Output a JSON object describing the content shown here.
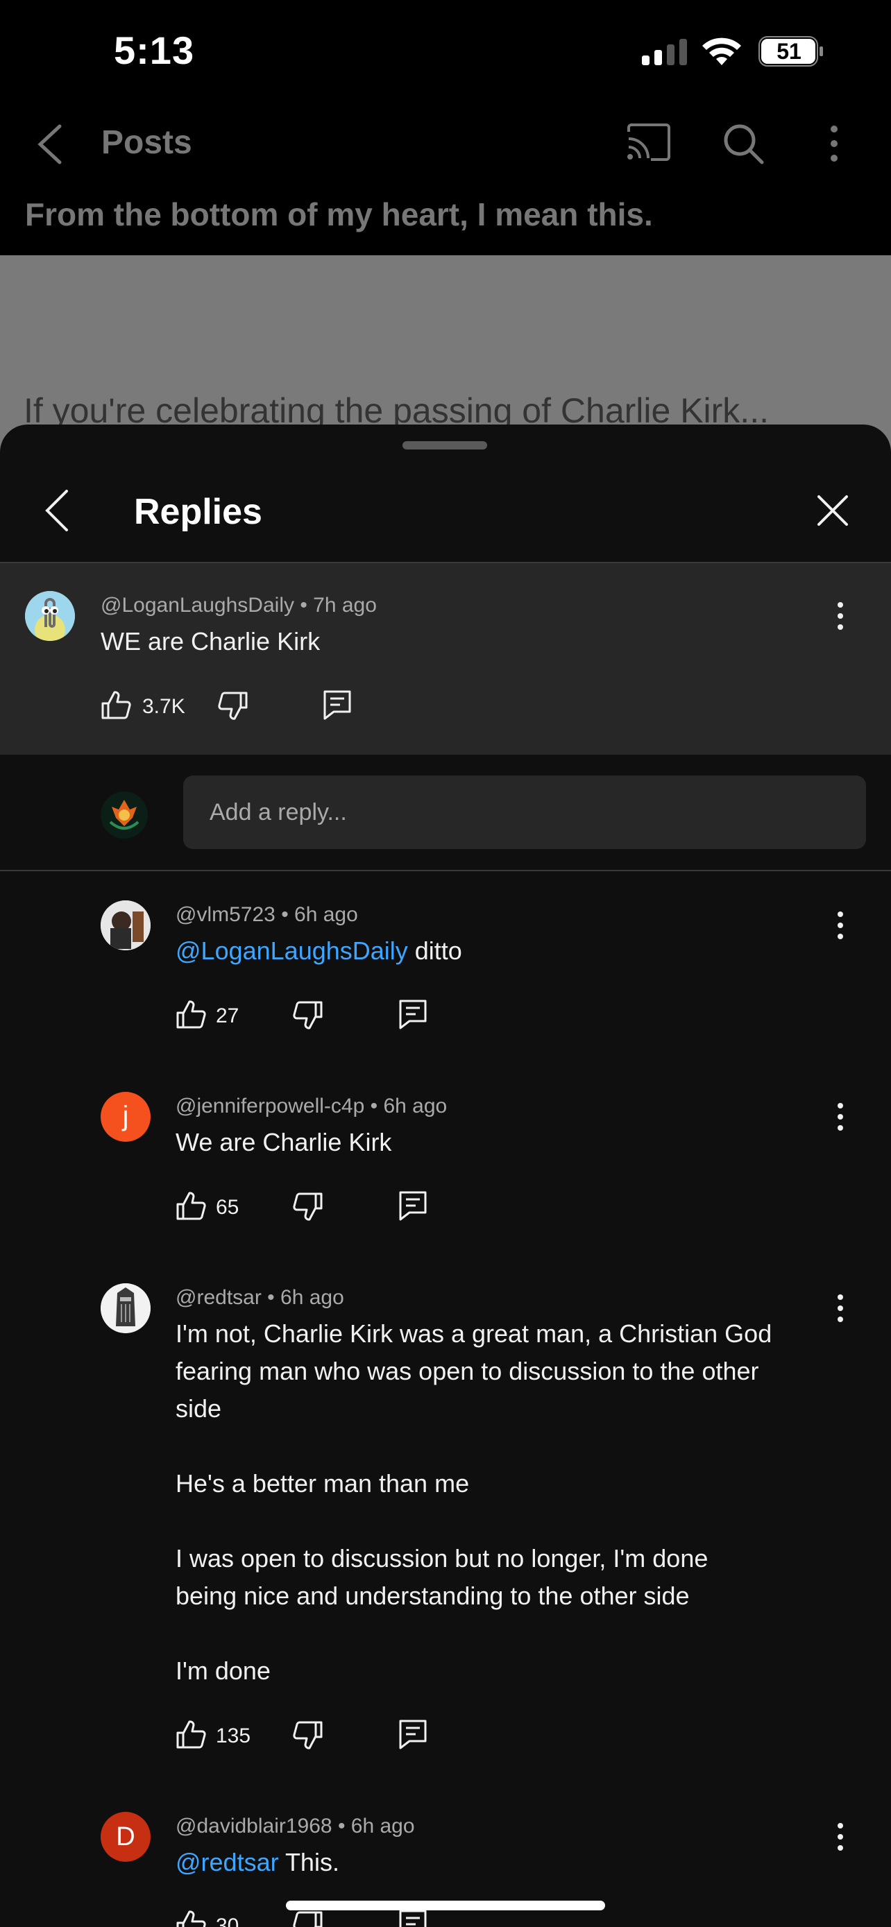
{
  "status_bar": {
    "time": "5:13",
    "battery": "51"
  },
  "background_page": {
    "title": "Posts",
    "post_title": "From the bottom of my heart, I mean this.",
    "post_caption": "If you're celebrating the passing of Charlie Kirk..."
  },
  "sheet": {
    "title": "Replies"
  },
  "parent_comment": {
    "author": "@LoganLaughsDaily",
    "time": "7h ago",
    "text": "WE are Charlie Kirk",
    "likes": "3.7K"
  },
  "reply_box": {
    "placeholder": "Add a reply..."
  },
  "replies": [
    {
      "author": "@vlm5723",
      "time": "6h ago",
      "mention": "@LoganLaughsDaily",
      "text": " ditto",
      "likes": "27",
      "avatar_letter": ""
    },
    {
      "author": "@jenniferpowell-c4p",
      "time": "6h ago",
      "mention": "",
      "text": "We are Charlie Kirk",
      "likes": "65",
      "avatar_letter": "j"
    },
    {
      "author": "@redtsar",
      "time": "6h ago",
      "mention": "",
      "lines": [
        "I'm not, Charlie Kirk was a great man, a Christian God",
        "fearing man who was open to discussion to the other",
        "side",
        "",
        "He's a better man than me",
        "",
        "I was open to discussion but no longer, I'm done",
        "being nice and understanding to the other side",
        "",
        "I'm done"
      ],
      "likes": "135",
      "avatar_letter": ""
    },
    {
      "author": "@davidblair1968",
      "time": "6h ago",
      "mention": "@redtsar",
      "text": " This.",
      "likes": "30",
      "avatar_letter": "D"
    }
  ],
  "colors": {
    "mention": "#3ea6ff",
    "sheet_bg": "#0f0f0f",
    "parent_bg": "#272727",
    "avatar_j": "#f4511e",
    "avatar_d": "#c62f12"
  },
  "icons": [
    "back-icon",
    "cast-icon",
    "search-icon",
    "more-vert-icon",
    "close-icon",
    "thumbs-up-icon",
    "thumbs-down-icon",
    "reply-icon"
  ]
}
